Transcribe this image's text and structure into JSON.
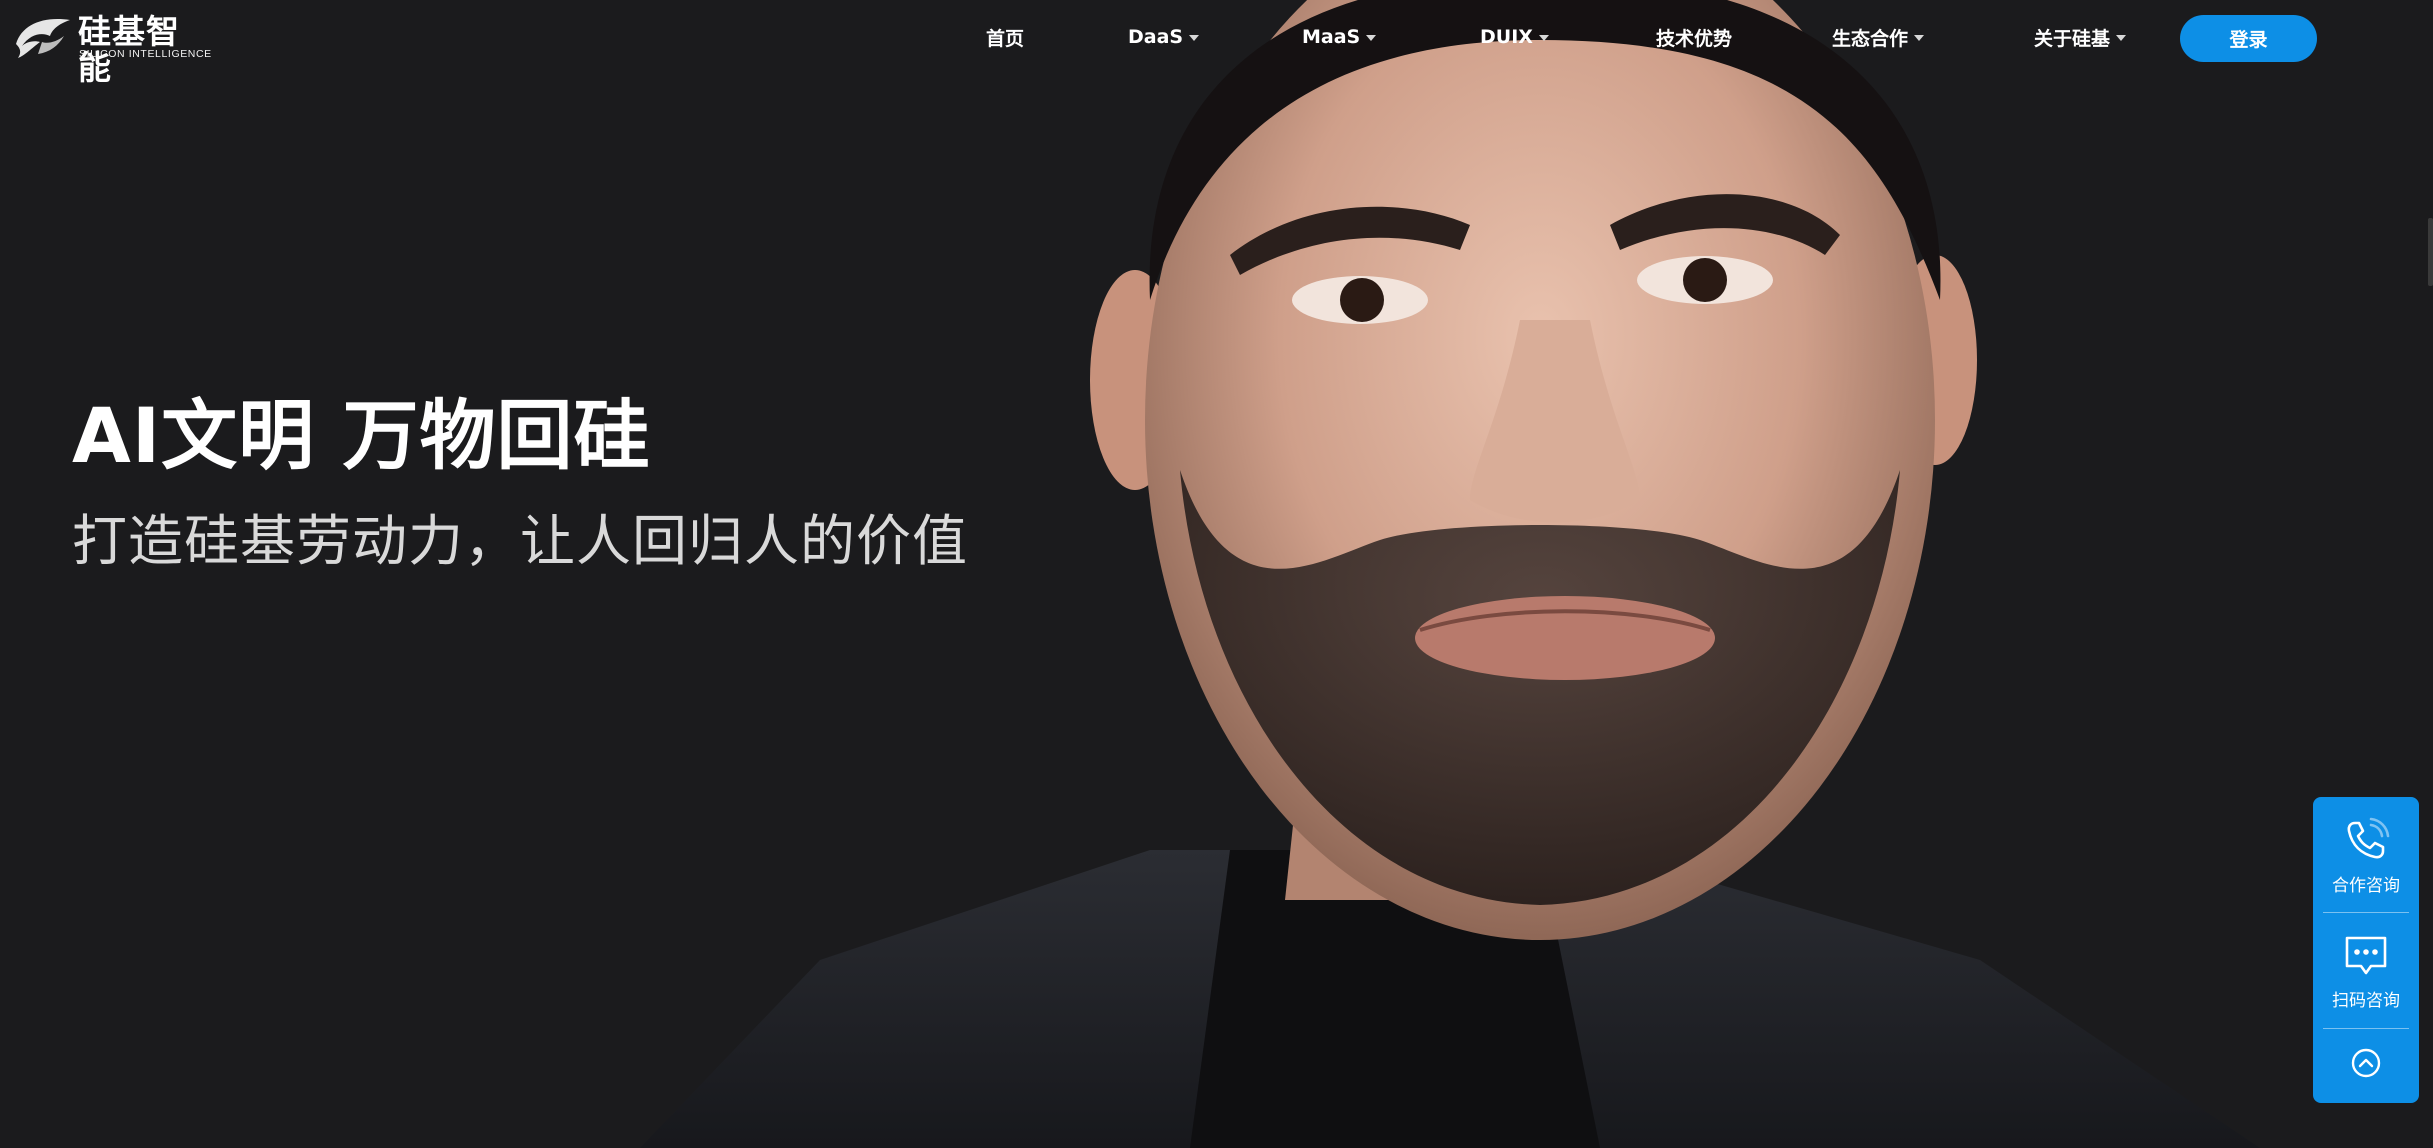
{
  "brand": {
    "name_cn": "硅基智能",
    "name_en": "SILICON INTELLIGENCE"
  },
  "nav": {
    "home": "首页",
    "daas": "DaaS",
    "maas": "MaaS",
    "duix": "DUIX",
    "tech": "技术优势",
    "eco": "生态合作",
    "about": "关于硅基",
    "login": "登录"
  },
  "hero": {
    "title": "AI文明 万物回硅",
    "subtitle": "打造硅基劳动力，让人回归人的价值"
  },
  "side_widget": {
    "consult_label": "合作咨询",
    "qr_label": "扫码咨询"
  },
  "colors": {
    "background": "#1b1b1d",
    "accent": "#0d8fe6"
  },
  "icons": {
    "consult": "phone-icon",
    "qr": "chat-bubble-icon",
    "top": "back-to-top-icon"
  }
}
